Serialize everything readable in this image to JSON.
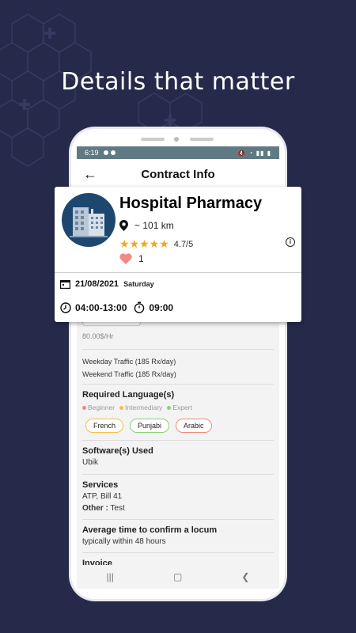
{
  "headline": "Details that matter",
  "status_bar": {
    "time": "6:19"
  },
  "app_bar": {
    "title": "Contract Info"
  },
  "card": {
    "name": "Hospital Pharmacy",
    "distance": "~ 101 km",
    "rating": "4.7/5",
    "rating_value": 4.7,
    "likes": "1",
    "date": "21/08/2021",
    "day": "Saturday",
    "hours": "04:00-13:00",
    "duration": "09:00"
  },
  "details": {
    "rate": "80.00$/Hr",
    "weekday_traffic": "Weekday Traffic (185 Rx/day)",
    "weekend_traffic": "Weekend Traffic (185 Rx/day)",
    "languages_label": "Required Language(s)",
    "levels": [
      {
        "label": "Beginner",
        "color": "#ee8a7a"
      },
      {
        "label": "Intermediary",
        "color": "#f2c04a"
      },
      {
        "label": "Expert",
        "color": "#8fd07a"
      }
    ],
    "languages": [
      {
        "label": "French",
        "color": "#f2c04a"
      },
      {
        "label": "Punjabi",
        "color": "#8fd07a"
      },
      {
        "label": "Arabic",
        "color": "#ee8a7a"
      }
    ],
    "software_label": "Software(s) Used",
    "software_value": "Ubik",
    "services_label": "Services",
    "services_value": "ATP, Bill 41",
    "other_label": "Other :",
    "other_value": "Test",
    "avg_time_label": "Average time to confirm a locum",
    "avg_time_value": "typically within 48 hours",
    "invoice_label": "Invoice"
  },
  "colors": {
    "background": "#262a4a",
    "status_bar": "#5f7a82",
    "logo_bg": "#1e4770",
    "star": "#f0a720",
    "heart": "#f08a84"
  }
}
